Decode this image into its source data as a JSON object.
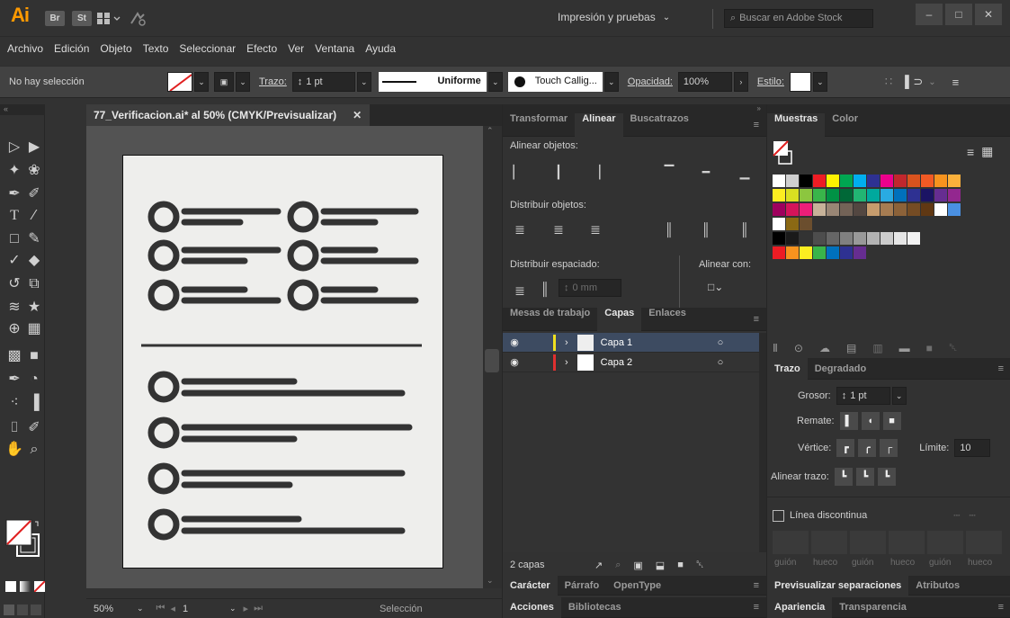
{
  "app": {
    "logo": "Ai",
    "badges": [
      "Br",
      "St"
    ],
    "workspace": "Impresión y pruebas",
    "stock_search_placeholder": "Buscar en Adobe Stock"
  },
  "menu": [
    "Archivo",
    "Edición",
    "Objeto",
    "Texto",
    "Seleccionar",
    "Efecto",
    "Ver",
    "Ventana",
    "Ayuda"
  ],
  "control": {
    "selection": "No hay selección",
    "stroke_label": "Trazo:",
    "stroke_value": "1 pt",
    "profile": "Uniforme",
    "brush": "Touch Callig...",
    "opacity_label": "Opacidad:",
    "opacity_value": "100%",
    "style_label": "Estilo:"
  },
  "document": {
    "tab_title": "77_Verificacion.ai* al 50% (CMYK/Previsualizar)",
    "zoom": "50%",
    "page": "1",
    "status_tool": "Selección"
  },
  "align_panel": {
    "tabs": [
      "Transformar",
      "Alinear",
      "Buscatrazos"
    ],
    "align_objects": "Alinear objetos:",
    "distribute_objects": "Distribuir objetos:",
    "distribute_spacing": "Distribuir espaciado:",
    "align_to": "Alinear con:",
    "spacing_value": "0 mm"
  },
  "layers_panel": {
    "tabs": [
      "Mesas de trabajo",
      "Capas",
      "Enlaces"
    ],
    "layers": [
      {
        "name": "Capa 1",
        "color": "#f0e020"
      },
      {
        "name": "Capa 2",
        "color": "#e03030"
      }
    ],
    "count": "2 capas"
  },
  "bottom_tabs_mid": {
    "char_tabs": [
      "Carácter",
      "Párrafo",
      "OpenType"
    ],
    "action_tabs": [
      "Acciones",
      "Bibliotecas"
    ]
  },
  "swatches_panel": {
    "tabs": [
      "Muestras",
      "Color"
    ]
  },
  "stroke_panel": {
    "tabs": [
      "Trazo",
      "Degradado"
    ],
    "weight_label": "Grosor:",
    "weight_value": "1 pt",
    "cap_label": "Remate:",
    "corner_label": "Vértice:",
    "limit_label": "Límite:",
    "limit_value": "10",
    "align_label": "Alinear trazo:",
    "dashed_label": "Línea discontinua",
    "dash_labels": [
      "guión",
      "hueco",
      "guión",
      "hueco",
      "guión",
      "hueco"
    ]
  },
  "bottom_tabs_right": {
    "sep_tabs": [
      "Previsualizar separaciones",
      "Atributos"
    ],
    "appearance_tabs": [
      "Apariencia",
      "Transparencia"
    ]
  },
  "colors": {
    "accent_orange": "#ff9a00",
    "selected_layer": "#3d4b61",
    "icon_dark": "#333333"
  }
}
